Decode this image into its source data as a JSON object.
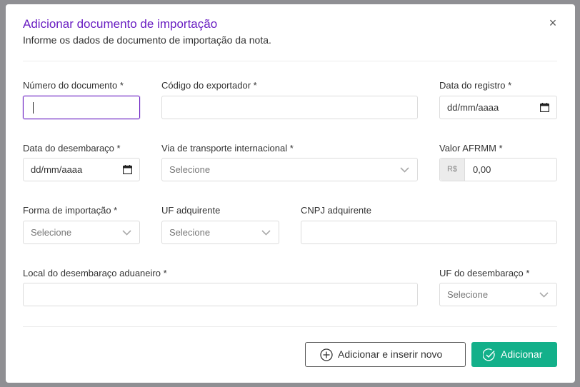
{
  "modal": {
    "title": "Adicionar documento de importação",
    "subtitle": "Informe os dados de documento de importação da nota.",
    "close_icon": "×"
  },
  "fields": {
    "numero_documento": {
      "label": "Número do documento *",
      "value": ""
    },
    "codigo_exportador": {
      "label": "Código do exportador *",
      "value": ""
    },
    "data_registro": {
      "label": "Data do registro *",
      "placeholder": "dd/mm/aaaa"
    },
    "data_desembaraco": {
      "label": "Data do desembaraço *",
      "placeholder": "dd/mm/aaaa"
    },
    "via_transporte": {
      "label": "Via de transporte internacional *",
      "selected": "Selecione"
    },
    "valor_afrmm": {
      "label": "Valor AFRMM *",
      "prefix": "R$",
      "value": "0,00"
    },
    "forma_importacao": {
      "label": "Forma de importação *",
      "selected": "Selecione"
    },
    "uf_adquirente": {
      "label": "UF adquirente",
      "selected": "Selecione"
    },
    "cnpj_adquirente": {
      "label": "CNPJ adquirente",
      "value": ""
    },
    "local_desembaraco": {
      "label": "Local do desembaraço aduaneiro *",
      "value": ""
    },
    "uf_desembaraco": {
      "label": "UF do desembaraço *",
      "selected": "Selecione"
    }
  },
  "footer": {
    "add_and_new_label": "Adicionar e inserir novo",
    "add_label": "Adicionar"
  },
  "colors": {
    "accent": "#6a1fc2",
    "primary_button": "#13b08a"
  },
  "icons": {
    "calendar": "calendar-icon",
    "chevron": "chevron-down-icon",
    "plus_circle": "plus-circle-icon",
    "check_circle": "check-circle-icon",
    "close": "close-icon"
  }
}
